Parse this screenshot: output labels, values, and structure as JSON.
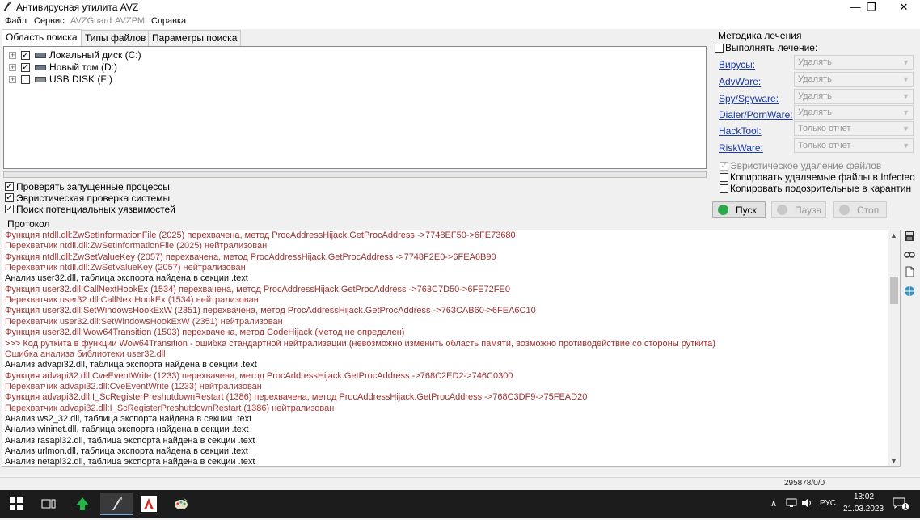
{
  "window": {
    "title": "Антивирусная утилита AVZ",
    "minimize": "—",
    "maximize": "❐",
    "close": "✕"
  },
  "menu": [
    "Файл",
    "Сервис",
    "AVZGuard",
    "AVZPM",
    "Справка"
  ],
  "tabs": [
    "Область поиска",
    "Типы файлов",
    "Параметры поиска"
  ],
  "drives": [
    {
      "label": "Локальный диск (C:)",
      "checked": true
    },
    {
      "label": "Новый том (D:)",
      "checked": true
    },
    {
      "label": "USB DISK (F:)",
      "checked": false
    }
  ],
  "scan_options": [
    {
      "label": "Проверять запущенные процессы",
      "checked": true
    },
    {
      "label": "Эвристическая проверка системы",
      "checked": true
    },
    {
      "label": "Поиск потенциальных уязвимостей",
      "checked": true
    }
  ],
  "treatment": {
    "title": "Методика лечения",
    "perform_label": "Выполнять лечение:",
    "threats": [
      {
        "label": "Вирусы:",
        "action": "Удалять"
      },
      {
        "label": "AdvWare:",
        "action": "Удалять"
      },
      {
        "label": "Spy/Spyware:",
        "action": "Удалять"
      },
      {
        "label": "Dialer/PornWare:",
        "action": "Удалять"
      },
      {
        "label": "HackTool:",
        "action": "Только отчет"
      },
      {
        "label": "RiskWare:",
        "action": "Только отчет"
      }
    ],
    "heuristic_delete": "Эвристическое удаление файлов",
    "copy_deleted": "Копировать удаляемые файлы в  Infected",
    "copy_suspicious": "Копировать подозрительные в  карантин"
  },
  "actions": {
    "start": "Пуск",
    "pause": "Пауза",
    "stop": "Стоп"
  },
  "protocol": {
    "label": "Протокол",
    "lines": [
      {
        "text": "Функция ntdll.dll:ZwSetInformationFile (2025) перехвачена, метод ProcAddressHijack.GetProcAddress ->7748EF50->6FE73680",
        "kind": "hook"
      },
      {
        "text": "Перехватчик ntdll.dll:ZwSetInformationFile (2025) нейтрализован",
        "kind": "neut"
      },
      {
        "text": "Функция ntdll.dll:ZwSetValueKey (2057) перехвачена, метод ProcAddressHijack.GetProcAddress ->7748F2E0->6FEA6B90",
        "kind": "hook"
      },
      {
        "text": "Перехватчик ntdll.dll:ZwSetValueKey (2057) нейтрализован",
        "kind": "neut"
      },
      {
        "text": "Анализ user32.dll, таблица экспорта найдена в секции .text",
        "kind": "info"
      },
      {
        "text": "Функция user32.dll:CallNextHookEx (1534) перехвачена, метод ProcAddressHijack.GetProcAddress ->763C7D50->6FE72FE0",
        "kind": "hook"
      },
      {
        "text": "Перехватчик user32.dll:CallNextHookEx (1534) нейтрализован",
        "kind": "neut"
      },
      {
        "text": "Функция user32.dll:SetWindowsHookExW (2351) перехвачена, метод ProcAddressHijack.GetProcAddress ->763CAB60->6FEA6C10",
        "kind": "hook"
      },
      {
        "text": "Перехватчик user32.dll:SetWindowsHookExW (2351) нейтрализован",
        "kind": "neut"
      },
      {
        "text": "Функция user32.dll:Wow64Transition (1503) перехвачена, метод CodeHijack (метод не определен)",
        "kind": "hook"
      },
      {
        "text": ">>> Код руткита в функции Wow64Transition - ошибка стандартной нейтрализации (невозможно изменить область памяти, возможно противодействие со стороны руткита)",
        "kind": "hook"
      },
      {
        "text": "Ошибка анализа библиотеки user32.dll",
        "kind": "neut"
      },
      {
        "text": "Анализ advapi32.dll, таблица экспорта найдена в секции .text",
        "kind": "info"
      },
      {
        "text": "Функция advapi32.dll:CveEventWrite (1233) перехвачена, метод ProcAddressHijack.GetProcAddress ->768C2ED2->746C0300",
        "kind": "hook"
      },
      {
        "text": "Перехватчик advapi32.dll:CveEventWrite (1233) нейтрализован",
        "kind": "neut"
      },
      {
        "text": "Функция advapi32.dll:I_ScRegisterPreshutdownRestart (1386) перехвачена, метод ProcAddressHijack.GetProcAddress ->768C3DF9->75FEAD20",
        "kind": "hook"
      },
      {
        "text": "Перехватчик advapi32.dll:I_ScRegisterPreshutdownRestart (1386) нейтрализован",
        "kind": "neut"
      },
      {
        "text": "Анализ ws2_32.dll, таблица экспорта найдена в секции .text",
        "kind": "info"
      },
      {
        "text": "Анализ wininet.dll, таблица экспорта найдена в секции .text",
        "kind": "info"
      },
      {
        "text": "Анализ rasapi32.dll, таблица экспорта найдена в секции .text",
        "kind": "info"
      },
      {
        "text": "Анализ urlmon.dll, таблица экспорта найдена в секции .text",
        "kind": "info"
      },
      {
        "text": "Анализ netapi32.dll, таблица экспорта найдена в секции .text",
        "kind": "info"
      }
    ]
  },
  "status": {
    "counter": "295878/0/0"
  },
  "taskbar": {
    "language": "РУС",
    "time": "13:02",
    "date": "21.03.2023",
    "notification_count": "1"
  },
  "colors": {
    "link": "#1a3aa8",
    "log_hook": "#9c2f2f",
    "start_icon": "#2aa84a",
    "taskbar": "#1c1c1c"
  }
}
